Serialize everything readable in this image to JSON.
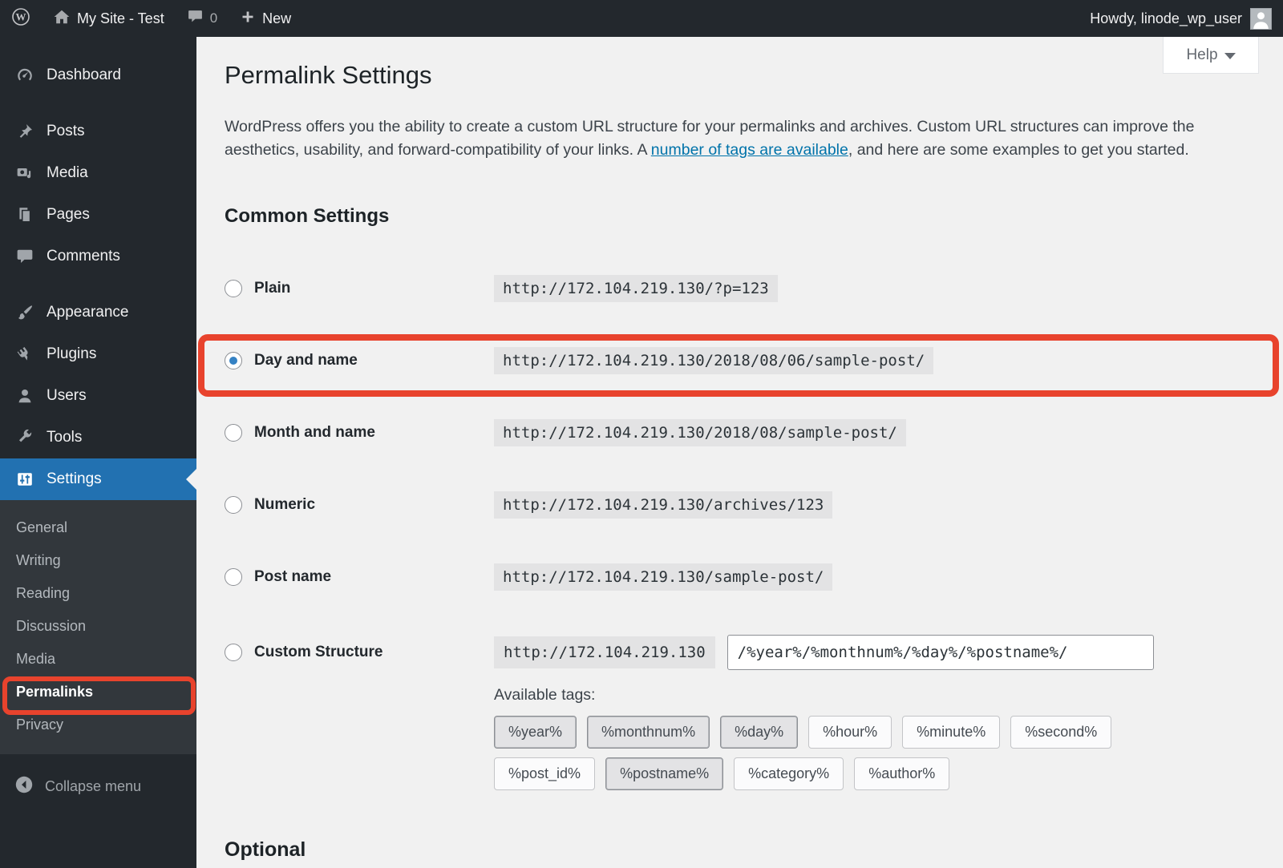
{
  "admin_bar": {
    "site_name": "My Site - Test",
    "comment_count": "0",
    "new_label": "New",
    "howdy": "Howdy, linode_wp_user"
  },
  "sidebar": {
    "items": [
      "Dashboard",
      "Posts",
      "Media",
      "Pages",
      "Comments",
      "Appearance",
      "Plugins",
      "Users",
      "Tools",
      "Settings"
    ],
    "settings_submenu": [
      "General",
      "Writing",
      "Reading",
      "Discussion",
      "Media",
      "Permalinks",
      "Privacy"
    ],
    "current_item": "Settings",
    "current_submenu_item": "Permalinks",
    "collapse_label": "Collapse menu"
  },
  "page": {
    "help_label": "Help",
    "title": "Permalink Settings",
    "intro": {
      "before_link": "WordPress offers you the ability to create a custom URL structure for your permalinks and archives. Custom URL structures can improve the aesthetics, usability, and forward-compatibility of your links. A ",
      "link": "number of tags are available",
      "after_link": ", and here are some examples to get you started."
    },
    "common_settings_heading": "Common Settings",
    "options": [
      {
        "label": "Plain",
        "url": "http://172.104.219.130/?p=123",
        "selected": false
      },
      {
        "label": "Day and name",
        "url": "http://172.104.219.130/2018/08/06/sample-post/",
        "selected": true,
        "annotated": true
      },
      {
        "label": "Month and name",
        "url": "http://172.104.219.130/2018/08/sample-post/",
        "selected": false
      },
      {
        "label": "Numeric",
        "url": "http://172.104.219.130/archives/123",
        "selected": false
      },
      {
        "label": "Post name",
        "url": "http://172.104.219.130/sample-post/",
        "selected": false
      }
    ],
    "custom_structure": {
      "label": "Custom Structure",
      "url_prefix": "http://172.104.219.130",
      "value": "/%year%/%monthnum%/%day%/%postname%/",
      "available_tags_label": "Available tags:",
      "tags_row1": [
        {
          "label": "%year%",
          "used": true
        },
        {
          "label": "%monthnum%",
          "used": true
        },
        {
          "label": "%day%",
          "used": true
        },
        {
          "label": "%hour%",
          "used": false
        },
        {
          "label": "%minute%",
          "used": false
        },
        {
          "label": "%second%",
          "used": false
        }
      ],
      "tags_row2": [
        {
          "label": "%post_id%",
          "used": false
        },
        {
          "label": "%postname%",
          "used": true
        },
        {
          "label": "%category%",
          "used": false
        },
        {
          "label": "%author%",
          "used": false
        }
      ]
    },
    "optional_heading": "Optional"
  },
  "colors": {
    "admin_dark": "#23282d",
    "submenu_bg": "#32373c",
    "active_menu_blue": "#2271b1",
    "link_blue": "#0073aa",
    "radio_dot_blue": "#3582c4",
    "annotation_red": "#e8432d",
    "page_bg": "#f1f1f1",
    "code_bg": "#e3e3e4"
  }
}
